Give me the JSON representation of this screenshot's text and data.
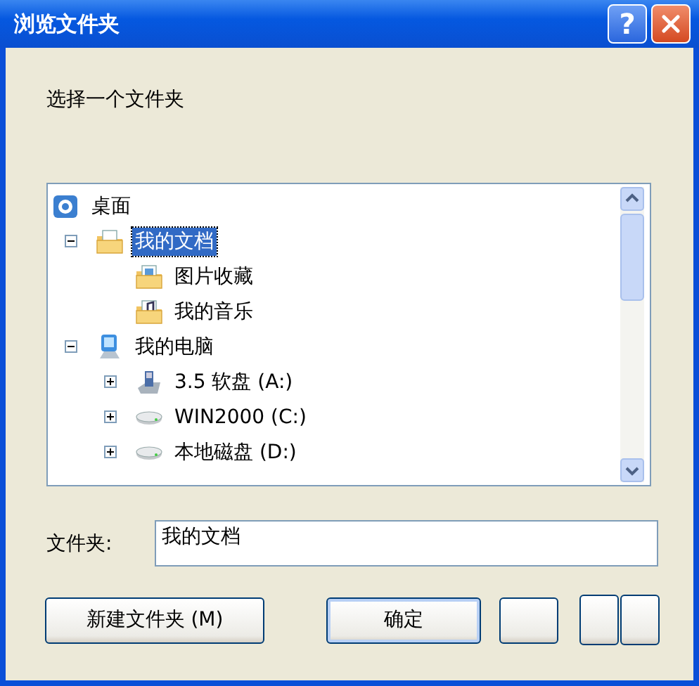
{
  "window": {
    "title": "浏览文件夹",
    "help_button": "?"
  },
  "prompt": "选择一个文件夹",
  "tree": [
    {
      "label": "桌面",
      "kind": "desktop",
      "selected": false,
      "children": [
        {
          "label": "我的文档",
          "kind": "documents",
          "expanded": true,
          "selected": true,
          "children": [
            {
              "label": "图片收藏",
              "kind": "pictures",
              "selected": false
            },
            {
              "label": "我的音乐",
              "kind": "music",
              "selected": false
            }
          ]
        },
        {
          "label": "我的电脑",
          "kind": "computer",
          "expanded": true,
          "selected": false,
          "children": [
            {
              "label": "3.5 软盘 (A:)",
              "kind": "floppy",
              "expanded": false,
              "selected": false
            },
            {
              "label": "WIN2000 (C:)",
              "kind": "drive",
              "expanded": false,
              "selected": false
            },
            {
              "label": "本地磁盘 (D:)",
              "kind": "drive",
              "expanded": false,
              "selected": false
            }
          ]
        }
      ]
    }
  ],
  "folder_field": {
    "label": "文件夹:",
    "value": "我的文档"
  },
  "buttons": [
    {
      "kind": "text",
      "label": "新建文件夹 (M)",
      "default": false
    },
    {
      "kind": "text",
      "label": "确定",
      "default": true
    },
    {
      "kind": "blank",
      "default": false
    },
    {
      "kind": "blank",
      "default": false
    },
    {
      "kind": "blank",
      "default": false
    }
  ]
}
